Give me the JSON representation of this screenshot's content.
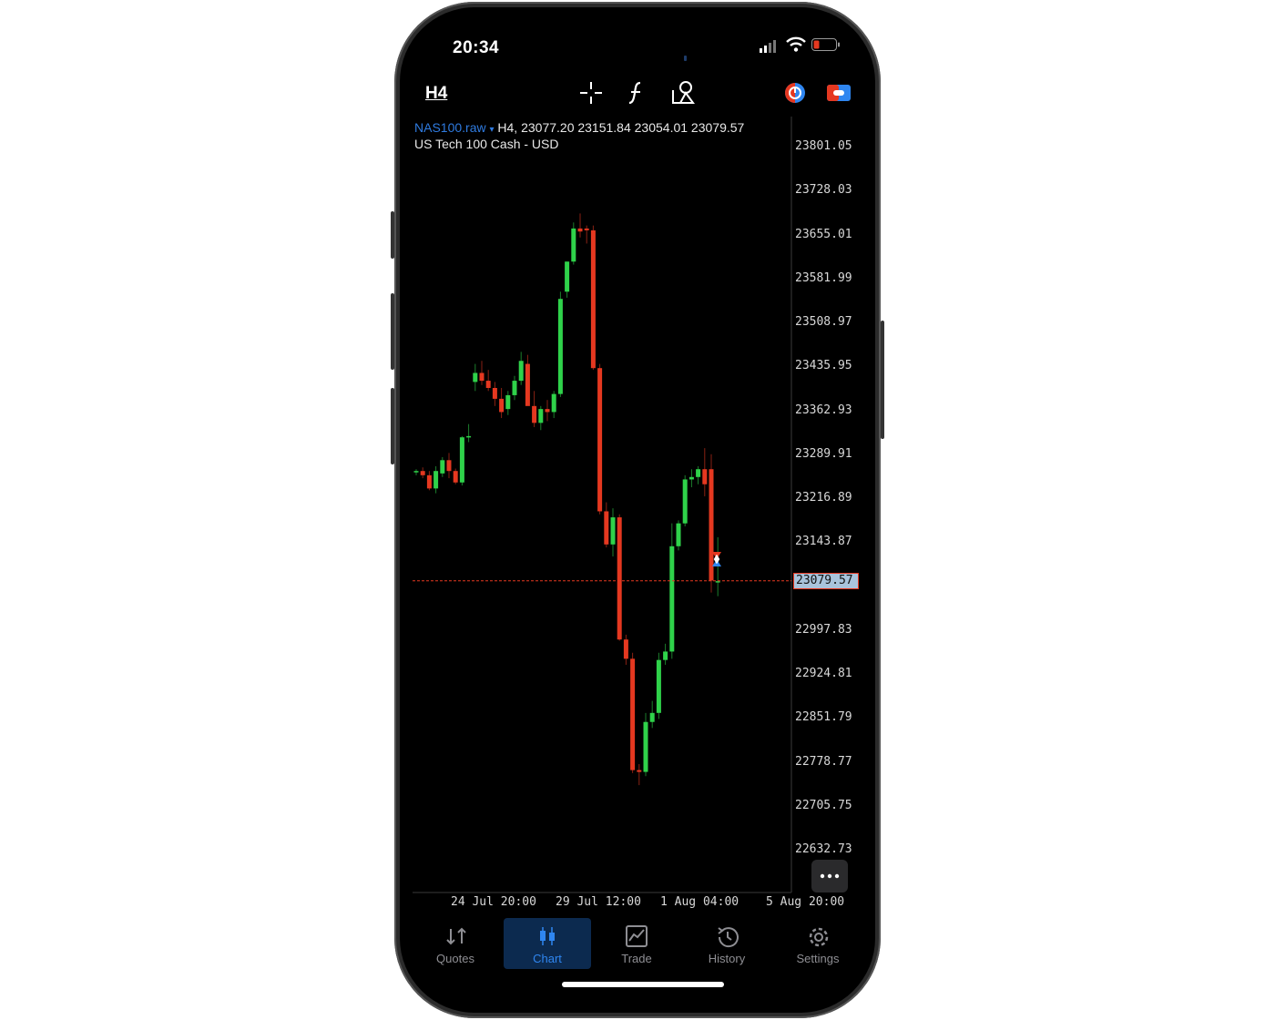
{
  "status": {
    "time": "20:34"
  },
  "toolbar": {
    "timeframe": "H4"
  },
  "chart_header": {
    "symbol": "NAS100.raw",
    "dropdown_glyph": "▾",
    "ohlc": "H4, 23077.20 23151.84 23054.01 23079.57",
    "description": "US Tech 100 Cash - USD"
  },
  "chart_data": {
    "type": "candlestick",
    "ylim": [
      22600,
      23830
    ],
    "y_ticks": [
      "23801.05",
      "23728.03",
      "23655.01",
      "23581.99",
      "23508.97",
      "23435.95",
      "23362.93",
      "23289.91",
      "23216.89",
      "23143.87",
      "22997.83",
      "22924.81",
      "22851.79",
      "22778.77",
      "22705.75",
      "22632.73"
    ],
    "current_price": "23079.57",
    "x_ticks": [
      "24 Jul 20:00",
      "29 Jul 12:00",
      "1 Aug 04:00",
      "5 Aug 20:00"
    ],
    "candles": [
      [
        23260,
        23265,
        23255,
        23262
      ],
      [
        23262,
        23268,
        23250,
        23255
      ],
      [
        23255,
        23262,
        23230,
        23233
      ],
      [
        23233,
        23270,
        23225,
        23262
      ],
      [
        23258,
        23285,
        23252,
        23280
      ],
      [
        23280,
        23292,
        23250,
        23262
      ],
      [
        23262,
        23266,
        23240,
        23243
      ],
      [
        23243,
        23320,
        23238,
        23318
      ],
      [
        23318,
        23340,
        23310,
        23320
      ],
      [
        23410,
        23440,
        23395,
        23425
      ],
      [
        23425,
        23445,
        23405,
        23412
      ],
      [
        23412,
        23430,
        23395,
        23400
      ],
      [
        23400,
        23410,
        23370,
        23382
      ],
      [
        23382,
        23400,
        23350,
        23360
      ],
      [
        23365,
        23395,
        23355,
        23388
      ],
      [
        23388,
        23420,
        23380,
        23412
      ],
      [
        23412,
        23460,
        23405,
        23445
      ],
      [
        23440,
        23455,
        23380,
        23370
      ],
      [
        23370,
        23395,
        23335,
        23342
      ],
      [
        23342,
        23370,
        23330,
        23365
      ],
      [
        23365,
        23380,
        23345,
        23360
      ],
      [
        23360,
        23395,
        23350,
        23390
      ],
      [
        23390,
        23560,
        23385,
        23548
      ],
      [
        23560,
        23610,
        23550,
        23610
      ],
      [
        23610,
        23675,
        23605,
        23665
      ],
      [
        23665,
        23690,
        23650,
        23660
      ],
      [
        23665,
        23670,
        23640,
        23662
      ],
      [
        23662,
        23670,
        23430,
        23433
      ],
      [
        23433,
        23440,
        23190,
        23195
      ],
      [
        23195,
        23210,
        23135,
        23140
      ],
      [
        23140,
        23200,
        23120,
        23185
      ],
      [
        23185,
        23190,
        22980,
        22982
      ],
      [
        22982,
        22990,
        22940,
        22950
      ],
      [
        22950,
        22960,
        22760,
        22765
      ],
      [
        22765,
        22775,
        22740,
        22762
      ],
      [
        22762,
        22860,
        22755,
        22845
      ],
      [
        22845,
        22880,
        22835,
        22860
      ],
      [
        22860,
        22960,
        22850,
        22948
      ],
      [
        22948,
        22975,
        22940,
        22962
      ],
      [
        22962,
        23175,
        22950,
        23137
      ],
      [
        23137,
        23180,
        23130,
        23175
      ],
      [
        23175,
        23255,
        23170,
        23248
      ],
      [
        23248,
        23265,
        23235,
        23252
      ],
      [
        23252,
        23270,
        23240,
        23265
      ],
      [
        23265,
        23300,
        23220,
        23240
      ],
      [
        23265,
        23290,
        23060,
        23080
      ],
      [
        23077,
        23152,
        23054,
        23079
      ]
    ]
  },
  "tabs": [
    {
      "label": "Quotes"
    },
    {
      "label": "Chart"
    },
    {
      "label": "Trade"
    },
    {
      "label": "History"
    },
    {
      "label": "Settings"
    }
  ],
  "colors": {
    "up": "#2fd24a",
    "down": "#e53820",
    "accent": "#2f86f0",
    "background": "#000000"
  }
}
